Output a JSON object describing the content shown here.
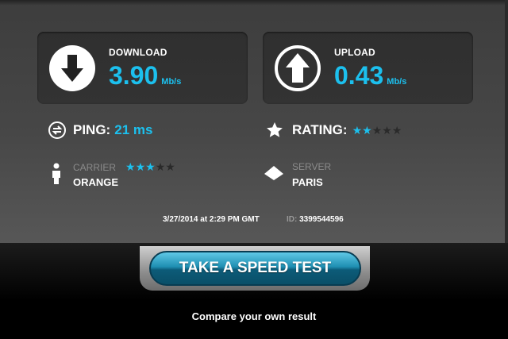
{
  "download": {
    "label": "DOWNLOAD",
    "value": "3.90",
    "unit": "Mb/s",
    "icon": "download-arrow-icon"
  },
  "upload": {
    "label": "UPLOAD",
    "value": "0.43",
    "unit": "Mb/s",
    "icon": "upload-arrow-icon"
  },
  "ping": {
    "label": "PING:",
    "value": "21 ms",
    "icon": "ping-icon"
  },
  "rating": {
    "label": "RATING:",
    "stars_filled": 2,
    "stars_total": 5,
    "icon": "star-icon"
  },
  "carrier": {
    "label": "CARRIER",
    "value": "ORANGE",
    "stars_filled": 3,
    "stars_total": 5,
    "icon": "person-icon"
  },
  "server": {
    "label": "SERVER",
    "value": "PARIS",
    "icon": "server-icon"
  },
  "meta": {
    "datetime": "3/27/2014 at 2:29 PM GMT",
    "id_label": "ID:",
    "id_value": "3399544596"
  },
  "action": {
    "button_label": "TAKE A SPEED TEST",
    "compare_text": "Compare your own result"
  },
  "colors": {
    "accent": "#1cc0ee",
    "button": "#1f8fb2",
    "background": "#474747"
  }
}
